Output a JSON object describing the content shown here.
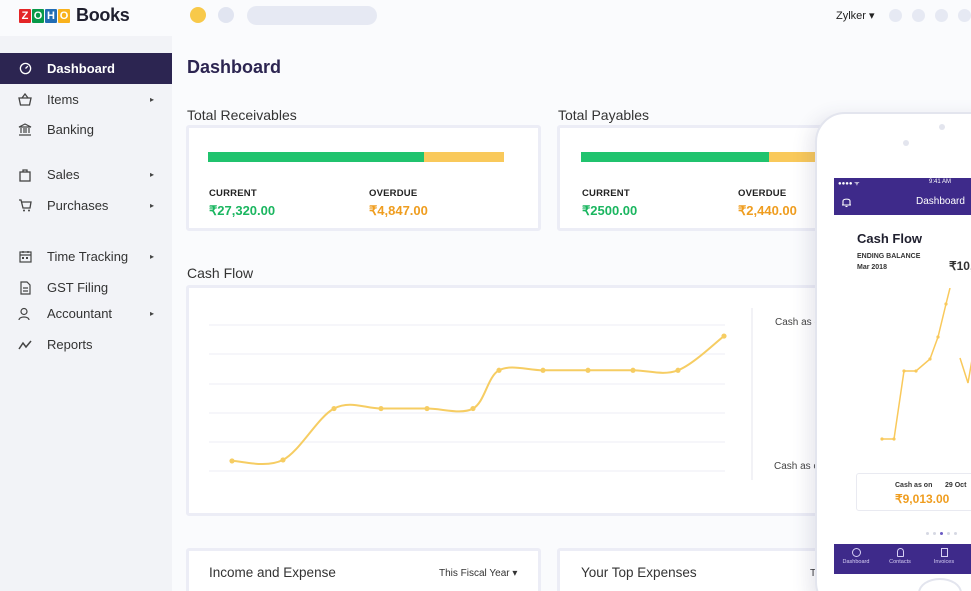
{
  "app": {
    "logo_letters": [
      "Z",
      "O",
      "H",
      "O"
    ],
    "logo_colors": [
      "#e42527",
      "#089949",
      "#226db4",
      "#f9b21d"
    ],
    "product": "Books",
    "org": "Zylker ▾"
  },
  "sidebar": {
    "items": [
      {
        "label": "Dashboard",
        "icon": "dashboard-icon",
        "active": true,
        "arrow": ""
      },
      {
        "label": "Items",
        "icon": "basket-icon",
        "arrow": "▸"
      },
      {
        "label": "Banking",
        "icon": "bank-icon",
        "arrow": ""
      },
      {
        "label": "Sales",
        "icon": "shopping-bag-icon",
        "arrow": "▸"
      },
      {
        "label": "Purchases",
        "icon": "cart-icon",
        "arrow": "▸"
      },
      {
        "label": "Time Tracking",
        "icon": "calendar-icon",
        "arrow": "▸"
      },
      {
        "label": "GST Filing",
        "icon": "document-icon",
        "arrow": ""
      },
      {
        "label": "Accountant",
        "icon": "user-icon",
        "arrow": "▸"
      },
      {
        "label": "Reports",
        "icon": "trend-icon",
        "arrow": ""
      }
    ]
  },
  "main": {
    "title": "Dashboard",
    "receivables": {
      "title": "Total Receivables",
      "current_label": "CURRENT",
      "current": "₹27,320.00",
      "overdue_label": "OVERDUE",
      "overdue": "₹4,847.00",
      "current_fraction": 0.73
    },
    "payables": {
      "title": "Total Payables",
      "current_label": "CURRENT",
      "current": "₹2500.00",
      "overdue_label": "OVERDUE",
      "overdue": "₹2,440.00",
      "current_fraction": 0.69
    },
    "cashflow": {
      "title": "Cash Flow",
      "label_top": "Cash as o",
      "label_bottom": "Cash as o",
      "series": [
        10,
        11,
        62,
        62,
        62,
        62,
        100,
        100,
        100,
        100,
        100,
        134
      ]
    },
    "income_expense": {
      "title": "Income and Expense",
      "period": "This Fiscal Year ▾"
    },
    "top_expenses": {
      "title": "Your Top Expenses",
      "period": "T"
    }
  },
  "phone": {
    "time": "9:41 AM",
    "signal": "●●●● ᯤ",
    "header": "Dashboard",
    "title": "Cash Flow",
    "ending_label": "ENDING BALANCE",
    "ending_date": "Mar 2018",
    "ending_value": "₹10,",
    "cash_as_on": "Cash as on",
    "cash_date": "29 Oct",
    "cash_value": "₹9,013.00",
    "tabs": [
      "Dashboard",
      "Contacts",
      "Invoices"
    ]
  },
  "colors": {
    "accent": "#2c2551",
    "green": "#20c36e",
    "yellow": "#f9c95b",
    "phone_header": "#3e2a8a"
  }
}
